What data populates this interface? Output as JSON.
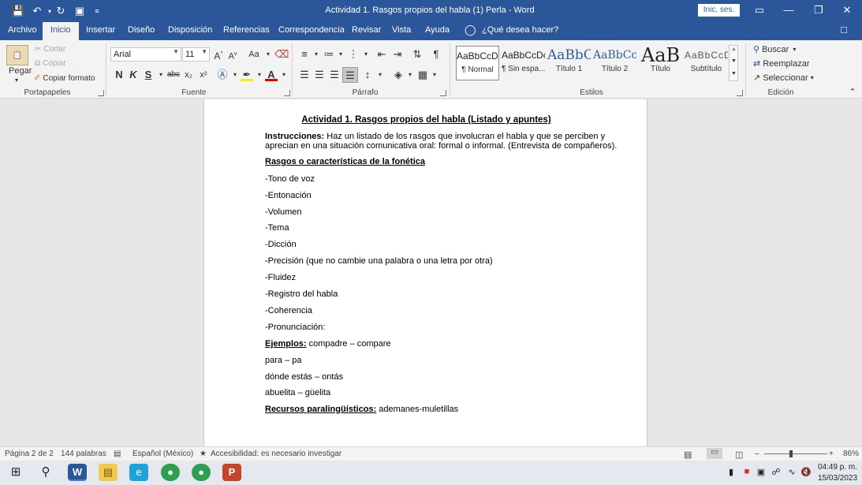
{
  "window": {
    "title": "Actividad 1. Rasgos propios del habla (1) Perla  -  Word",
    "signin": "Inic. ses."
  },
  "tabs": [
    "Archivo",
    "Inicio",
    "Insertar",
    "Diseño",
    "Disposición",
    "Referencias",
    "Correspondencia",
    "Revisar",
    "Vista",
    "Ayuda"
  ],
  "tellme": "¿Qué desea hacer?",
  "ribbon": {
    "clipboard": {
      "paste": "Pegar",
      "cut": "Cortar",
      "copy": "Copiar",
      "format_painter": "Copiar formato",
      "label": "Portapapeles"
    },
    "font": {
      "name": "Arial",
      "size": "11",
      "label": "Fuente",
      "aa": "Aa",
      "bold": "N",
      "italic": "K",
      "underline": "S",
      "strike": "abc",
      "sub": "x₂",
      "sup": "x²"
    },
    "paragraph": {
      "label": "Párrafo"
    },
    "styles": {
      "label": "Estilos",
      "items": [
        {
          "sample": "AaBbCcDc",
          "name": "¶ Normal"
        },
        {
          "sample": "AaBbCcDc",
          "name": "¶ Sin espa..."
        },
        {
          "sample": "AaBbC",
          "name": "Título 1"
        },
        {
          "sample": "AaBbCcl",
          "name": "Título 2"
        },
        {
          "sample": "AaB",
          "name": "Título"
        },
        {
          "sample": "AaBbCcD",
          "name": "Subtítulo"
        }
      ]
    },
    "editing": {
      "find": "Buscar",
      "replace": "Reemplazar",
      "select": "Seleccionar",
      "label": "Edición"
    }
  },
  "document": {
    "heading": "Actividad 1. Rasgos propios del habla (Listado y apuntes)",
    "instructions_label": "Instrucciones:",
    "instructions_line1": " Haz un listado de los rasgos que involucran el habla y que se  perciben  y",
    "instructions_line2": "aprecian en una situación comunicativa oral: formal o informal. (Entrevista de compañeros).",
    "section_title": "Rasgos o características de la fonética",
    "items": [
      "-Tono de voz",
      "-Entonación",
      "-Volumen",
      "-Tema",
      "-Dicción",
      "-Precisión (que no cambie una palabra o una letra por otra)",
      "-Fluidez",
      "-Registro del habla",
      "-Coherencia",
      "-Pronunciación:"
    ],
    "examples_label": "Ejemplos:",
    "examples_first": " compadre – compare",
    "examples": [
      "para – pa",
      "dónde estás – ontás",
      "abuelita – güelita"
    ],
    "resources_label": "Recursos paralingüísticos:",
    "resources_text": " ademanes-muletillas"
  },
  "status": {
    "page": "Página 2 de 2",
    "words": "144 palabras",
    "language": "Español (México)",
    "accessibility": "Accesibilidad: es necesario investigar",
    "zoom": "86%",
    "zoom_level": 86
  },
  "taskbar": {
    "time": "04:49 p. m.",
    "date": "15/03/2023"
  }
}
